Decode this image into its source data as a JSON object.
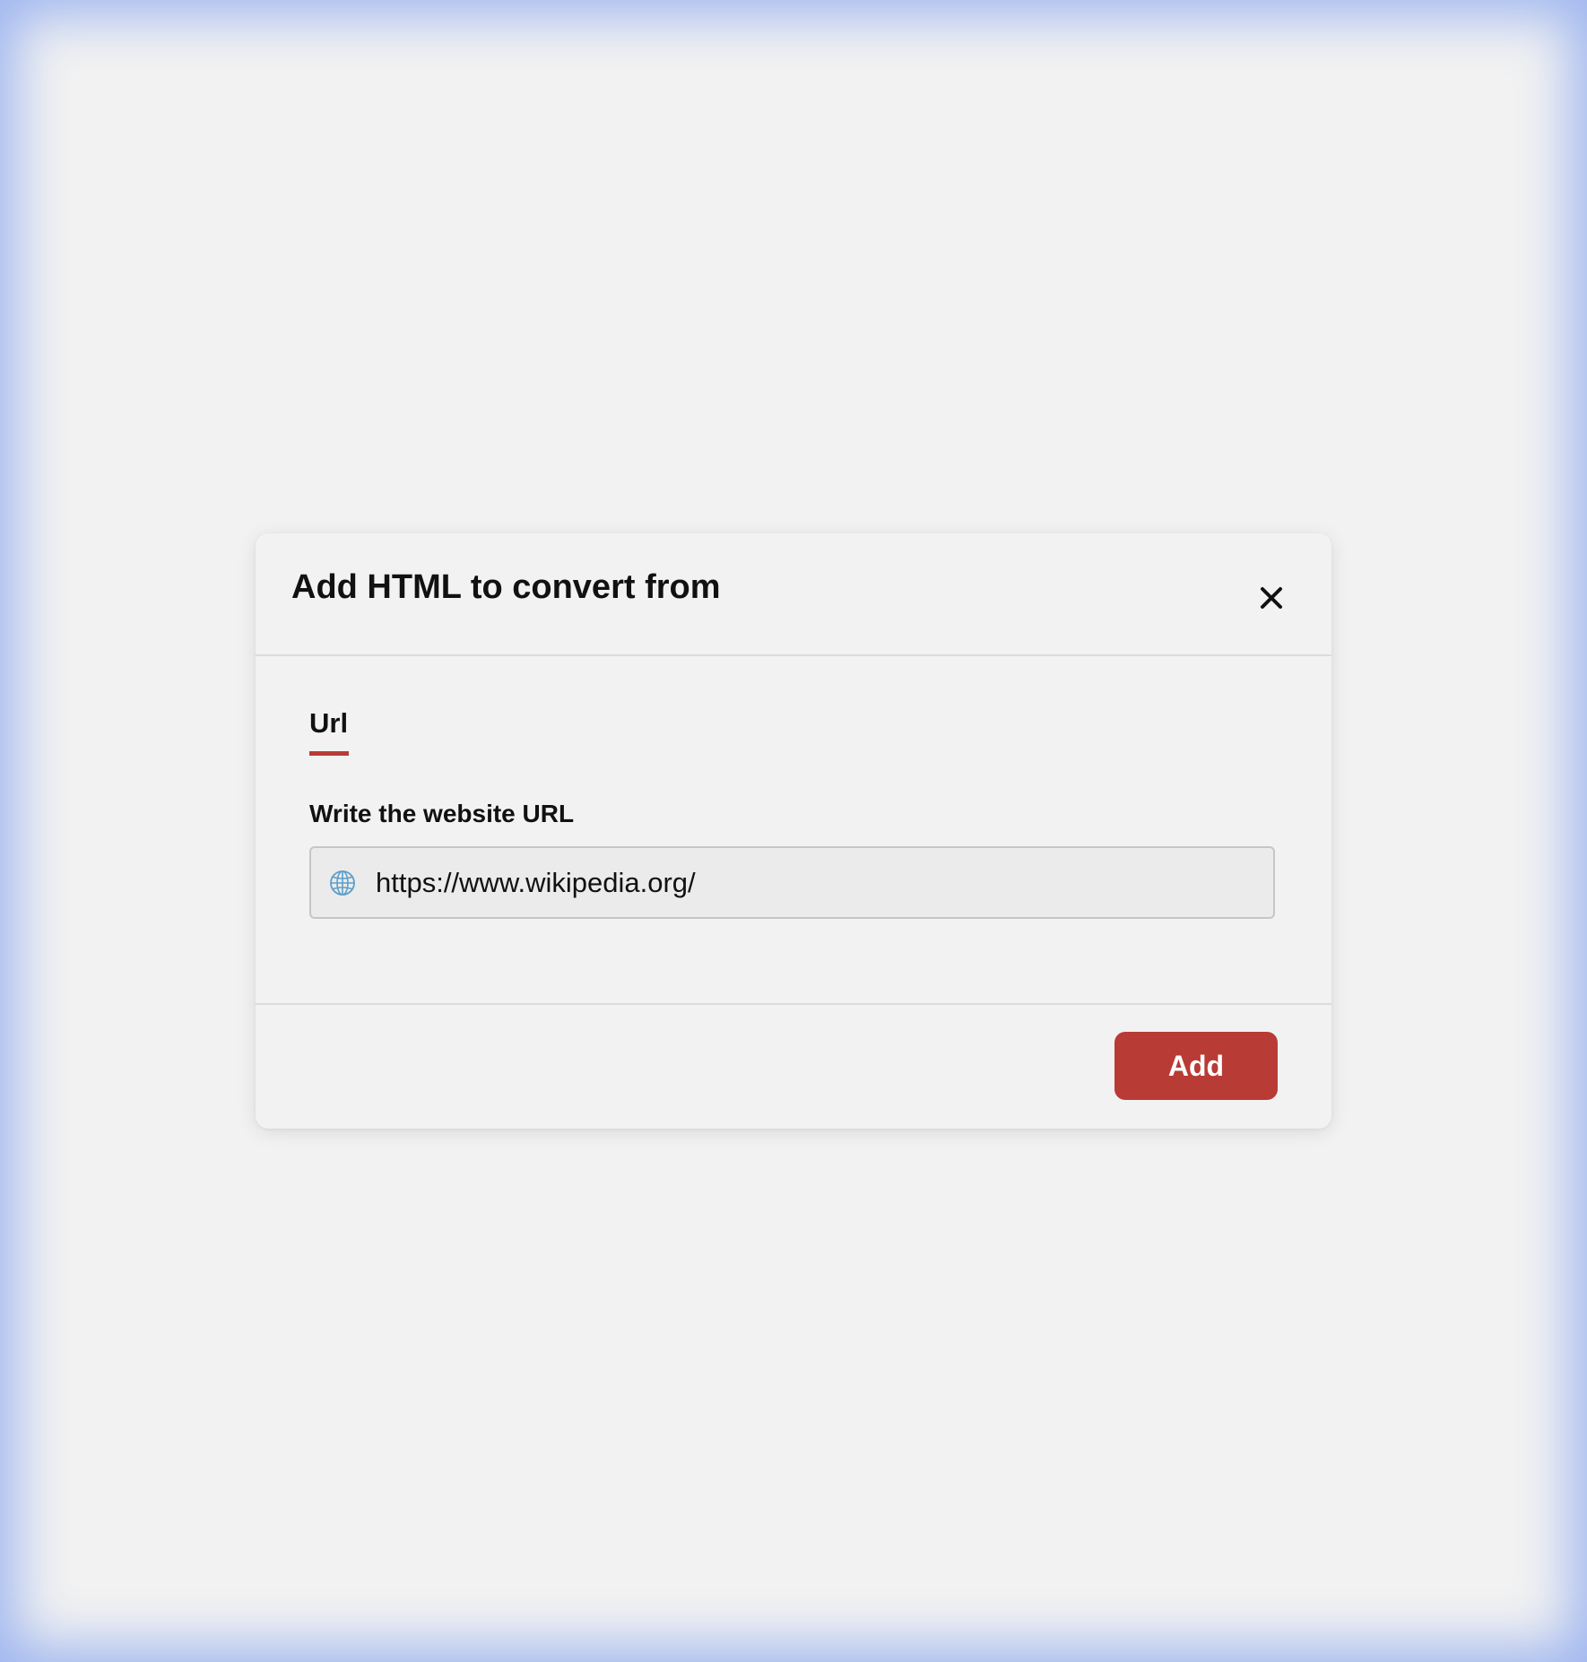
{
  "dialog": {
    "title": "Add HTML to convert from",
    "close_icon": "close-icon"
  },
  "tabs": [
    {
      "label": "Url",
      "active": true
    }
  ],
  "url_field": {
    "label": "Write the website URL",
    "value": "https://www.wikipedia.org/",
    "icon": "globe-icon"
  },
  "footer": {
    "add_label": "Add"
  },
  "colors": {
    "accent": "#b83b36",
    "background": "#f2f2f2",
    "input_background": "#ebebeb",
    "border_glow": "#9fb6ef"
  }
}
